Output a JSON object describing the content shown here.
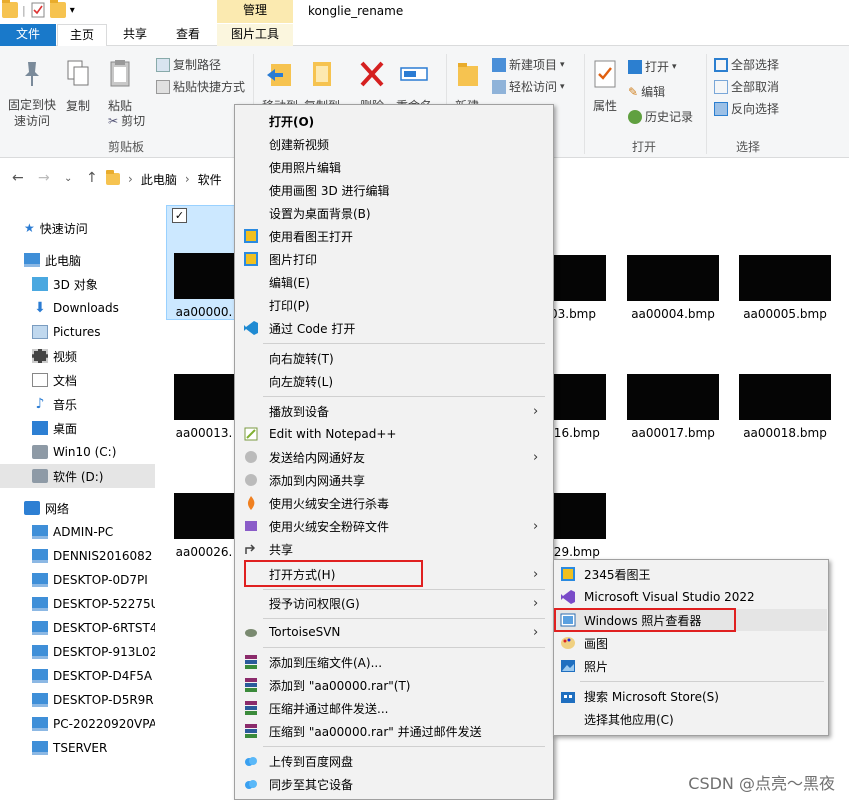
{
  "window": {
    "title": "konglie_rename",
    "context_tab_header": "管理"
  },
  "tabs": {
    "file": "文件",
    "home": "主页",
    "share": "共享",
    "view": "查看",
    "picture_tools": "图片工具"
  },
  "ribbon": {
    "pin": "固定到快\n速访问",
    "copy": "复制",
    "paste": "粘贴",
    "copy_path": "复制路径",
    "paste_shortcut": "粘贴快捷方式",
    "cut": "剪切",
    "move_to": "移动到",
    "copy_to": "复制到",
    "delete": "删除",
    "rename": "重命名",
    "new_folder": "新建",
    "new_item": "新建项目",
    "easy_access": "轻松访问",
    "properties": "属性",
    "open": "打开",
    "edit": "编辑",
    "history": "历史记录",
    "select_all": "全部选择",
    "select_none": "全部取消",
    "invert": "反向选择",
    "group_clipboard": "剪贴板",
    "group_open": "打开",
    "group_select": "选择"
  },
  "address": {
    "crumbs": [
      "此电脑",
      "软件"
    ]
  },
  "sidebar": {
    "items": [
      {
        "label": "快速访问"
      },
      {
        "label": "此电脑"
      },
      {
        "label": "3D 对象"
      },
      {
        "label": "Downloads"
      },
      {
        "label": "Pictures"
      },
      {
        "label": "视频"
      },
      {
        "label": "文档"
      },
      {
        "label": "音乐"
      },
      {
        "label": "桌面"
      },
      {
        "label": "Win10 (C:)"
      },
      {
        "label": "软件 (D:)"
      },
      {
        "label": "网络"
      },
      {
        "label": "ADMIN-PC"
      },
      {
        "label": "DENNIS2016082"
      },
      {
        "label": "DESKTOP-0D7PI"
      },
      {
        "label": "DESKTOP-52275U"
      },
      {
        "label": "DESKTOP-6RTST4"
      },
      {
        "label": "DESKTOP-913L02"
      },
      {
        "label": "DESKTOP-D4F5A"
      },
      {
        "label": "DESKTOP-D5R9R"
      },
      {
        "label": "PC-20220920VPA"
      },
      {
        "label": "TSERVER"
      }
    ]
  },
  "files": [
    {
      "name": "aa00000."
    },
    {
      "name": "03.bmp"
    },
    {
      "name": "aa00004.bmp"
    },
    {
      "name": "aa00005.bmp"
    },
    {
      "name": "aa00013."
    },
    {
      "name": "016.bmp"
    },
    {
      "name": "aa00017.bmp"
    },
    {
      "name": "aa00018.bmp"
    },
    {
      "name": "aa00026."
    },
    {
      "name": "029.bmp"
    }
  ],
  "context_menu": {
    "items": [
      {
        "label": "打开(O)"
      },
      {
        "label": "创建新视频"
      },
      {
        "label": "使用照片编辑"
      },
      {
        "label": "使用画图 3D 进行编辑"
      },
      {
        "label": "设置为桌面背景(B)"
      },
      {
        "label": "使用看图王打开"
      },
      {
        "label": "图片打印"
      },
      {
        "label": "编辑(E)"
      },
      {
        "label": "打印(P)"
      },
      {
        "label": "通过 Code 打开"
      },
      {
        "label": "向右旋转(T)"
      },
      {
        "label": "向左旋转(L)"
      },
      {
        "label": "播放到设备"
      },
      {
        "label": "Edit with Notepad++"
      },
      {
        "label": "发送给内网通好友"
      },
      {
        "label": "添加到内网通共享"
      },
      {
        "label": "使用火绒安全进行杀毒"
      },
      {
        "label": "使用火绒安全粉碎文件"
      },
      {
        "label": "共享"
      },
      {
        "label": "打开方式(H)"
      },
      {
        "label": "授予访问权限(G)"
      },
      {
        "label": "TortoiseSVN"
      },
      {
        "label": "添加到压缩文件(A)..."
      },
      {
        "label": "添加到 \"aa00000.rar\"(T)"
      },
      {
        "label": "压缩并通过邮件发送..."
      },
      {
        "label": "压缩到 \"aa00000.rar\" 并通过邮件发送"
      },
      {
        "label": "上传到百度网盘"
      },
      {
        "label": "同步至其它设备"
      }
    ]
  },
  "submenu": {
    "items": [
      {
        "label": "2345看图王"
      },
      {
        "label": "Microsoft Visual Studio 2022"
      },
      {
        "label": "Windows 照片查看器"
      },
      {
        "label": "画图"
      },
      {
        "label": "照片"
      },
      {
        "label": "搜索 Microsoft Store(S)"
      },
      {
        "label": "选择其他应用(C)"
      }
    ]
  },
  "watermark": "CSDN @点亮～黑夜",
  "colors": {
    "accent": "#1979ca",
    "highlight_box": "#e02020",
    "selection": "#cce8ff"
  }
}
